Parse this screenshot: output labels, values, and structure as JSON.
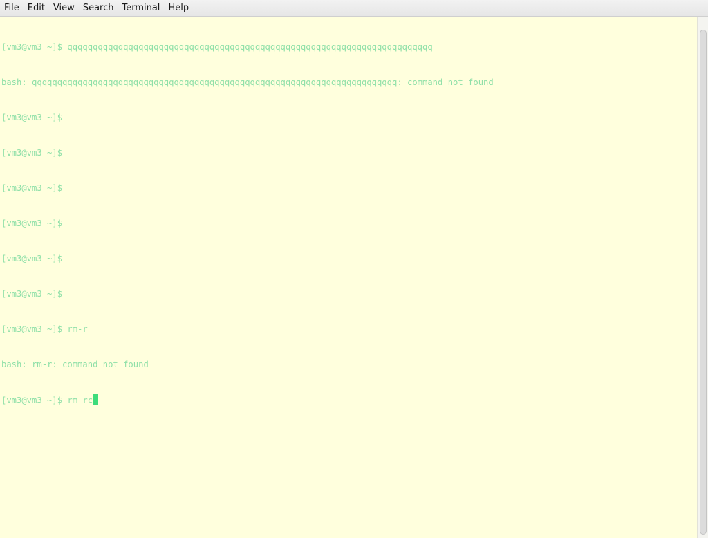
{
  "menubar": {
    "items": [
      {
        "label": "File"
      },
      {
        "label": "Edit"
      },
      {
        "label": "View"
      },
      {
        "label": "Search"
      },
      {
        "label": "Terminal"
      },
      {
        "label": "Help"
      }
    ]
  },
  "terminal": {
    "colors": {
      "background": "#ffffdd",
      "text": "#8fe0a8",
      "cursor": "#3ddc7a"
    },
    "lines": [
      "[vm3@vm3 ~]$ qqqqqqqqqqqqqqqqqqqqqqqqqqqqqqqqqqqqqqqqqqqqqqqqqqqqqqqqqqqqqqqqqqqqqqqq",
      "bash: qqqqqqqqqqqqqqqqqqqqqqqqqqqqqqqqqqqqqqqqqqqqqqqqqqqqqqqqqqqqqqqqqqqqqqqq: command not found",
      "[vm3@vm3 ~]$",
      "[vm3@vm3 ~]$",
      "[vm3@vm3 ~]$",
      "[vm3@vm3 ~]$",
      "[vm3@vm3 ~]$",
      "[vm3@vm3 ~]$",
      "[vm3@vm3 ~]$ rm-r",
      "bash: rm-r: command not found"
    ],
    "current_line": "[vm3@vm3 ~]$ rm rc"
  }
}
